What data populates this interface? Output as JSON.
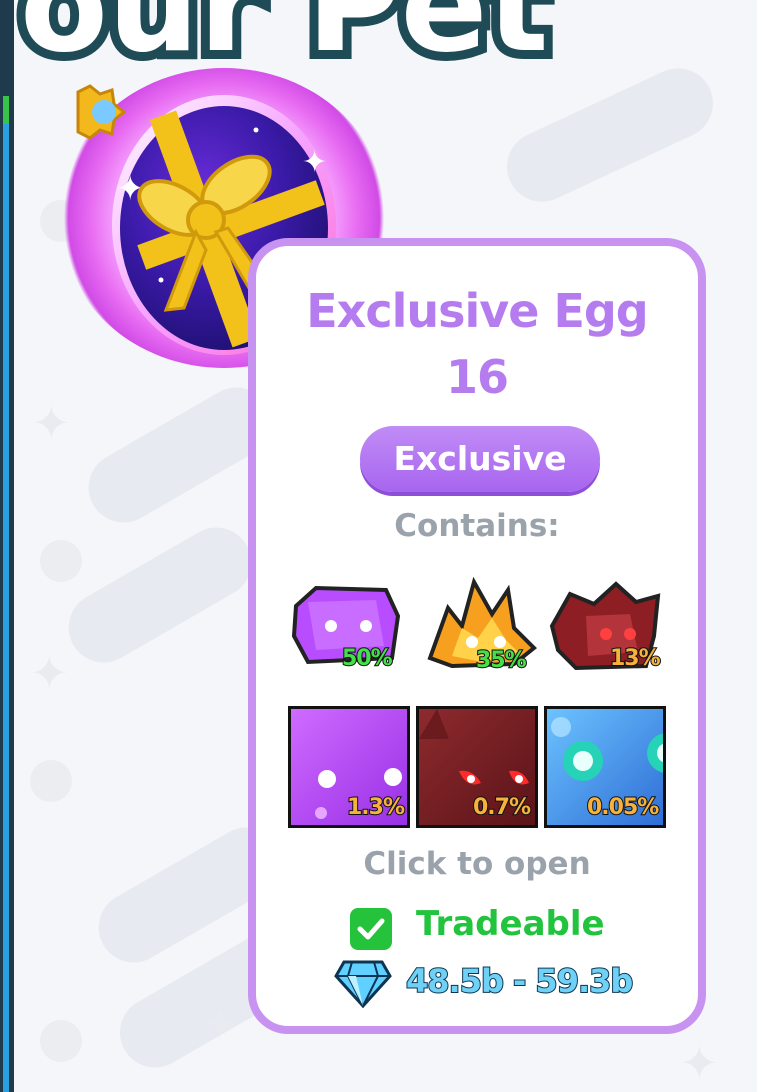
{
  "header": {
    "title_partial": "our Pet"
  },
  "card": {
    "title_line1": "Exclusive Egg",
    "title_line2": "16",
    "badge": "Exclusive",
    "contains_label": "Contains:",
    "pets": [
      {
        "name": "purple-cube-pet",
        "chance": "50%",
        "color": "green"
      },
      {
        "name": "fire-fox-pet",
        "chance": "35%",
        "color": "green"
      },
      {
        "name": "dark-red-dragon-pet",
        "chance": "13%",
        "color": "orange"
      },
      {
        "name": "purple-tile-pet",
        "chance": "1.3%",
        "color": "orange"
      },
      {
        "name": "red-demon-tile-pet",
        "chance": "0.7%",
        "color": "orange"
      },
      {
        "name": "blue-eyed-tile-pet",
        "chance": "0.05%",
        "color": "orange"
      }
    ],
    "click_label": "Click to open",
    "tradeable_label": "Tradeable",
    "price_range": "48.5b - 59.3b"
  },
  "colors": {
    "accent": "#b57cef",
    "border": "#c892f0",
    "tradeable": "#22c33d",
    "price": "#6fd1f5"
  },
  "icons": [
    "egg-icon",
    "checkbox-icon",
    "diamond-icon"
  ]
}
